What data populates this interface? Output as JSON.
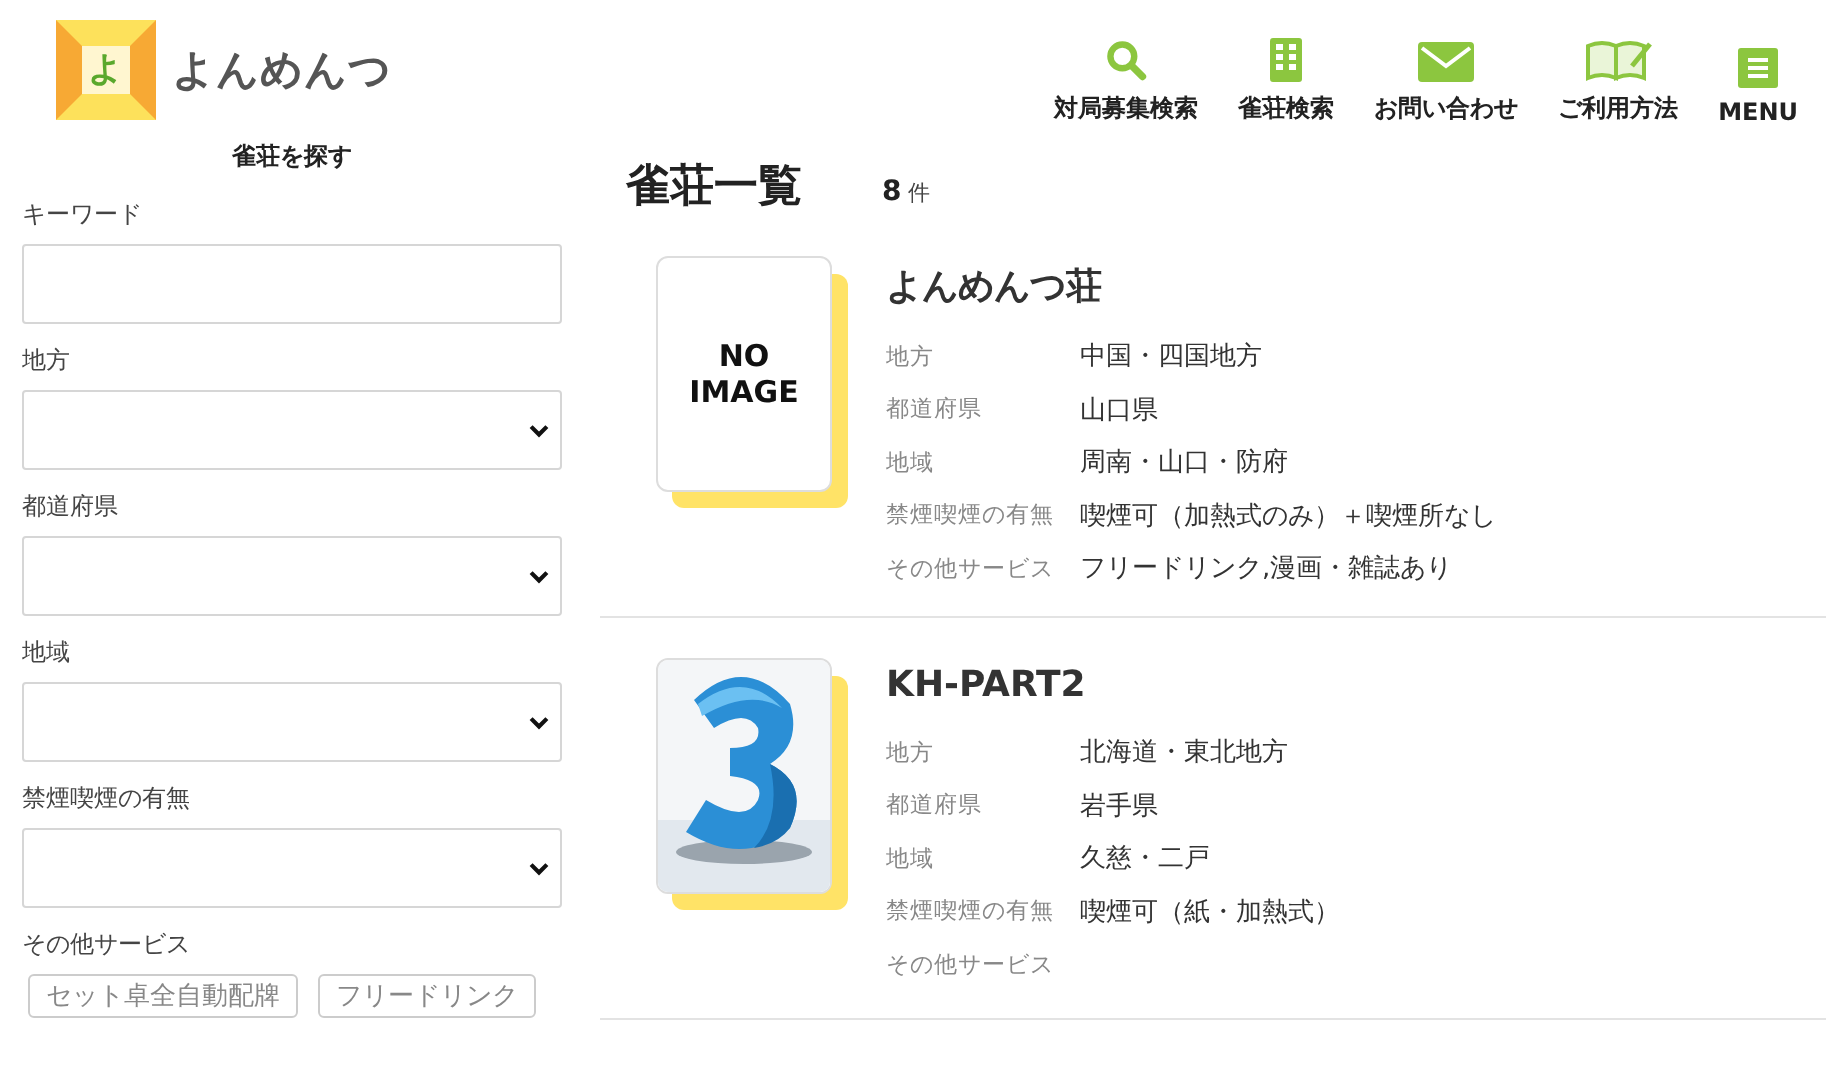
{
  "header": {
    "logo_mark": "よ",
    "logo_text": "よんめんつ",
    "nav": [
      {
        "kind": "search",
        "label": "対局募集検索"
      },
      {
        "kind": "building",
        "label": "雀荘検索"
      },
      {
        "kind": "mail",
        "label": "お問い合わせ"
      },
      {
        "kind": "book",
        "label": "ご利用方法"
      },
      {
        "kind": "menu",
        "label": "MENU"
      }
    ]
  },
  "sidebar": {
    "title": "雀荘を探す",
    "fields": [
      {
        "kind": "text",
        "label": "キーワード"
      },
      {
        "kind": "select",
        "label": "地方"
      },
      {
        "kind": "select",
        "label": "都道府県"
      },
      {
        "kind": "select",
        "label": "地域"
      },
      {
        "kind": "select",
        "label": "禁煙喫煙の有無"
      }
    ],
    "services_label": "その他サービス",
    "service_buttons": [
      "セット卓全自動配牌",
      "フリードリンク"
    ]
  },
  "main": {
    "title": "雀荘一覧",
    "count": "8",
    "count_unit": "件",
    "shops": [
      {
        "name": "よんめんつ荘",
        "thumbnail": {
          "kind": "no_image",
          "line1": "NO",
          "line2": "IMAGE"
        },
        "details": [
          {
            "label": "地方",
            "value": "中国・四国地方"
          },
          {
            "label": "都道府県",
            "value": "山口県"
          },
          {
            "label": "地域",
            "value": "周南・山口・防府"
          },
          {
            "label": "禁煙喫煙の有無",
            "value": "喫煙可（加熱式のみ）＋喫煙所なし"
          },
          {
            "label": "その他サービス",
            "value": "フリードリンク,漫画・雑誌あり"
          }
        ]
      },
      {
        "name": "KH-PART2",
        "details": [
          {
            "label": "地方",
            "value": "北海道・東北地方"
          },
          {
            "label": "都道府県",
            "value": "岩手県"
          },
          {
            "label": "地域",
            "value": "久慈・二戸"
          },
          {
            "label": "禁煙喫煙の有無",
            "value": "喫煙可（紙・加熱式）"
          },
          {
            "label": "その他サービス"
          }
        ]
      }
    ]
  }
}
